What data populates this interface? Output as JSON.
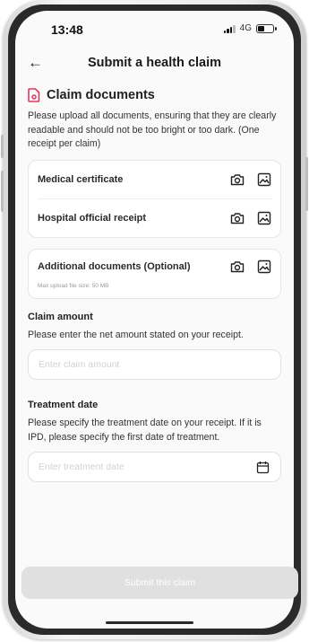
{
  "status_bar": {
    "time": "13:48",
    "network": "4G"
  },
  "header": {
    "back_icon": "arrow-left-icon",
    "title": "Submit a health claim"
  },
  "documents": {
    "icon": "document-icon",
    "title": "Claim documents",
    "intro": "Please upload all documents, ensuring that they are clearly readable and should not be too bright or too dark. (One receipt per claim)",
    "items": [
      {
        "label": "Medical certificate"
      },
      {
        "label": "Hospital official receipt"
      }
    ],
    "additional": {
      "label": "Additional documents (Optional)",
      "note": "Max upload file size: 50 MB"
    },
    "accent_color": "#e8345a"
  },
  "claim_amount": {
    "label": "Claim amount",
    "help": "Please enter the net amount stated on your receipt.",
    "placeholder": "Enter claim amount"
  },
  "treatment_date": {
    "label": "Treatment date",
    "help": "Please specify the treatment date on your receipt. If it is IPD, please specify the first date of treatment.",
    "placeholder": "Enter treatment date",
    "icon": "calendar-icon"
  },
  "submit": {
    "label": "Submit this claim",
    "state": "disabled"
  }
}
